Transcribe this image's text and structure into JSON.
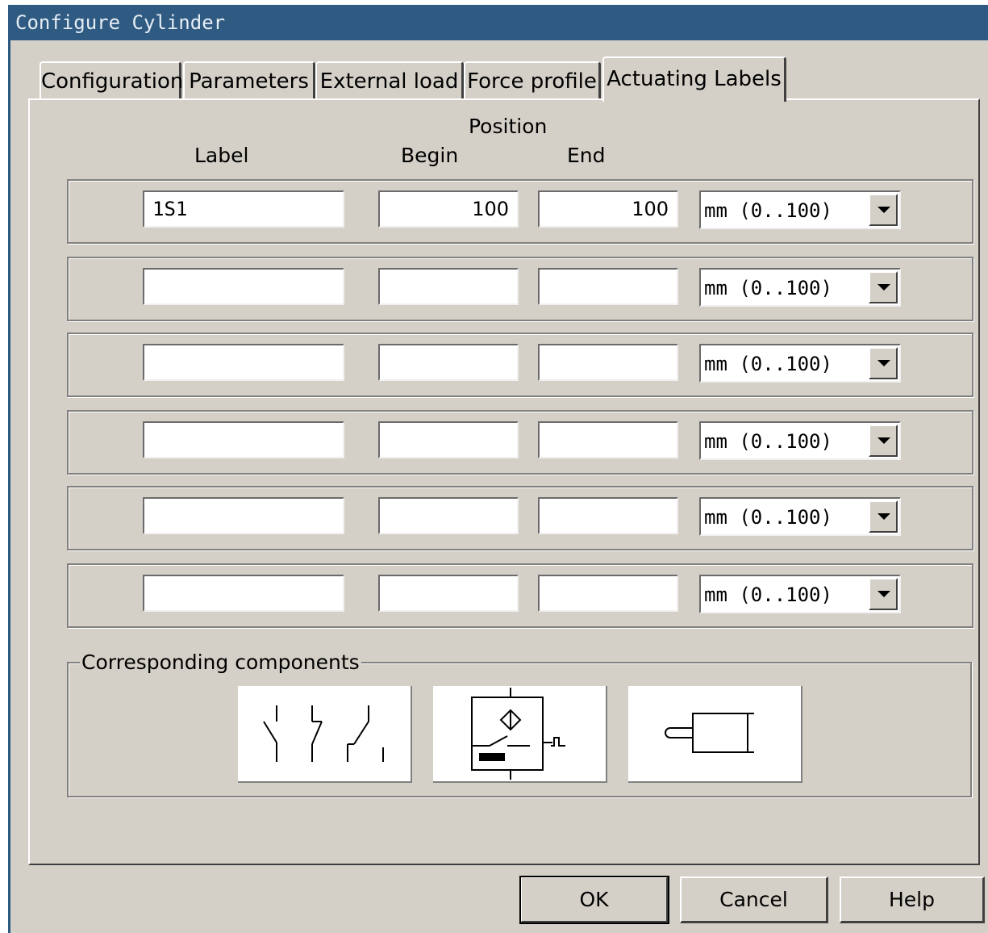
{
  "window": {
    "title": "Configure Cylinder"
  },
  "tabs": [
    {
      "label": "Configuration"
    },
    {
      "label": "Parameters"
    },
    {
      "label": "External load"
    },
    {
      "label": "Force profile"
    },
    {
      "label": "Actuating Labels",
      "active": true
    }
  ],
  "headers": {
    "position": "Position",
    "label": "Label",
    "begin": "Begin",
    "end": "End"
  },
  "rows": [
    {
      "label": "1S1",
      "begin": "100",
      "end": "100",
      "unit": "mm  (0..100)"
    },
    {
      "label": "",
      "begin": "",
      "end": "",
      "unit": "mm  (0..100)"
    },
    {
      "label": "",
      "begin": "",
      "end": "",
      "unit": "mm  (0..100)"
    },
    {
      "label": "",
      "begin": "",
      "end": "",
      "unit": "mm  (0..100)"
    },
    {
      "label": "",
      "begin": "",
      "end": "",
      "unit": "mm  (0..100)"
    },
    {
      "label": "",
      "begin": "",
      "end": "",
      "unit": "mm  (0..100)"
    }
  ],
  "components": {
    "title": "Corresponding components",
    "items": [
      {
        "icon": "switch-contacts-icon"
      },
      {
        "icon": "proximity-sensor-icon"
      },
      {
        "icon": "cylinder-icon"
      }
    ]
  },
  "buttons": {
    "ok": "OK",
    "cancel": "Cancel",
    "help": "Help"
  }
}
